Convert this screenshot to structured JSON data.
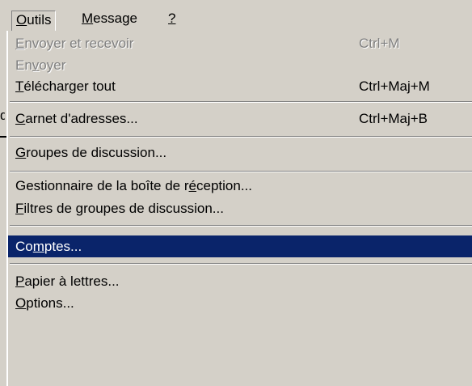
{
  "menubar": {
    "items": [
      {
        "label": "Outils",
        "mnemonic": "O"
      },
      {
        "label": "Message",
        "mnemonic": "M"
      },
      {
        "label": "?",
        "mnemonic": "?"
      }
    ]
  },
  "underlay": {
    "fragment": "d"
  },
  "menu": {
    "items": [
      {
        "label": "Envoyer et recevoir",
        "mnemonic_index": 0,
        "shortcut": "Ctrl+M",
        "disabled": true
      },
      {
        "label": "Envoyer",
        "mnemonic_index": 2,
        "shortcut": "",
        "disabled": true
      },
      {
        "label": "Télécharger tout",
        "mnemonic_index": 0,
        "shortcut": "Ctrl+Maj+M",
        "disabled": false
      },
      {
        "label": "Carnet d'adresses...",
        "mnemonic_index": 0,
        "shortcut": "Ctrl+Maj+B",
        "disabled": false
      },
      {
        "label": "Groupes de discussion...",
        "mnemonic_index": 0,
        "shortcut": "",
        "disabled": false
      },
      {
        "label": "Gestionnaire de la boîte de réception...",
        "mnemonic_index": 29,
        "shortcut": "",
        "disabled": false
      },
      {
        "label": "Filtres de groupes de discussion...",
        "mnemonic_index": 0,
        "shortcut": "",
        "disabled": false
      },
      {
        "label": "Comptes...",
        "mnemonic_index": 2,
        "shortcut": "",
        "disabled": false,
        "selected": true
      },
      {
        "label": "Papier à lettres...",
        "mnemonic_index": 0,
        "shortcut": "",
        "disabled": false
      },
      {
        "label": "Options...",
        "mnemonic_index": 0,
        "shortcut": "",
        "disabled": false
      }
    ]
  },
  "colors": {
    "face": "#d4d0c8",
    "highlight": "#0a246a",
    "disabled_text": "#808080"
  }
}
